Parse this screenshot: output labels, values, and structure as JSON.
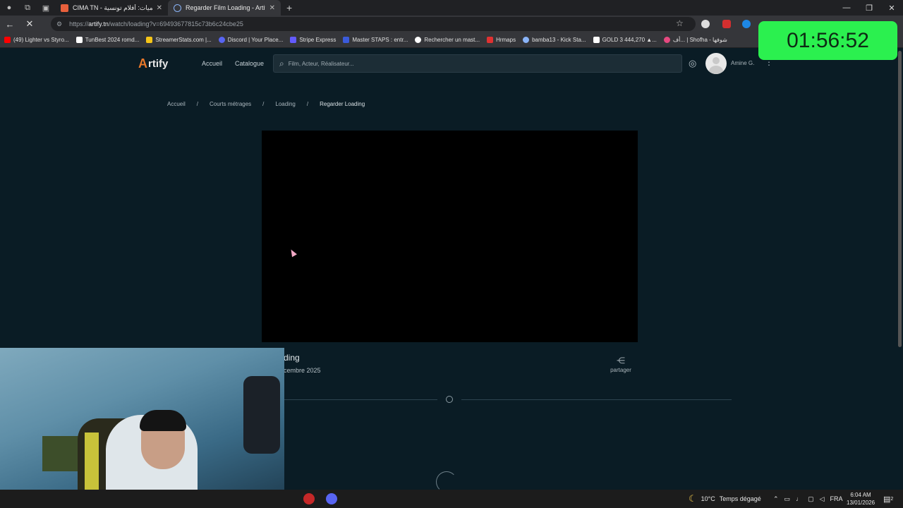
{
  "browser": {
    "tabs": [
      {
        "title": "CIMA TN - التسميات: أفلام تونسية",
        "active": false
      },
      {
        "title": "Regarder Film Loading - Artify",
        "active": true
      }
    ],
    "url_host": "artify.tn",
    "url_path": "/watch/loading?v=69493677815c73b6c24cbe25",
    "url_scheme": "https://",
    "window_controls": [
      "—",
      "❐",
      "✕"
    ]
  },
  "bookmarks": [
    {
      "label": "(49) Lighter vs Styro...",
      "color": "#ff0000"
    },
    {
      "label": "TunBest 2024 romd...",
      "color": "#ffffff"
    },
    {
      "label": "StreamerStats.com |...",
      "color": "#f5c518"
    },
    {
      "label": "Discord | Your Place...",
      "color": "#5865f2"
    },
    {
      "label": "Stripe Express",
      "color": "#635bff"
    },
    {
      "label": "Master STAPS : entr...",
      "color": "#3b5bdb"
    },
    {
      "label": "Rechercher un mast...",
      "color": "#ffffff"
    },
    {
      "label": "Hrmaps",
      "color": "#e03131"
    },
    {
      "label": "bamba13 - Kick Sta...",
      "color": "#53fc18"
    },
    {
      "label": "GOLD 3 444,270 ▲...",
      "color": "#ffffff"
    },
    {
      "label": "أف... | Shofha - شوفها",
      "color": "#e64980"
    }
  ],
  "site": {
    "logo_letter": "A",
    "logo_text": "rtify",
    "nav": [
      "Accueil",
      "Catalogue"
    ],
    "search_placeholder": "Film, Acteur, Réalisateur...",
    "user_name": "Amine G."
  },
  "breadcrumb": {
    "items": [
      "Accueil",
      "Courts métrages",
      "Loading"
    ],
    "separator": "/",
    "current": "Regarder Loading"
  },
  "video": {
    "title_visible": "ding",
    "date_visible": "cembre 2025",
    "share_label": "partager"
  },
  "overlay": {
    "timer": "01:56:52"
  },
  "taskbar": {
    "weather_temp": "10°C",
    "weather_desc": "Temps dégagé",
    "language": "FRA",
    "time": "6:04 AM",
    "date": "13/01/2026",
    "notifications": "2"
  }
}
